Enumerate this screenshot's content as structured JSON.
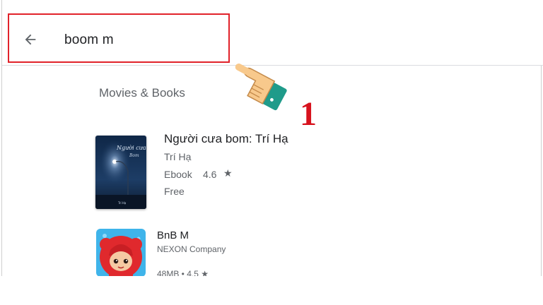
{
  "search": {
    "query": "boom m",
    "back_icon": "arrow-left-icon"
  },
  "section": {
    "title": "Movies & Books"
  },
  "book": {
    "title": "Người cưa bom: Trí Hạ",
    "author": "Trí Hạ",
    "type": "Ebook",
    "rating": "4.6",
    "star": "★",
    "price": "Free",
    "cover_title_line1": "Người cưa",
    "cover_title_line2": "Bom",
    "cover_author": "Trí Hạ"
  },
  "app": {
    "title": "BnB M",
    "developer": "NEXON Company",
    "meta": "48MB • 4.5 ★"
  },
  "annotation": {
    "step_number": "1",
    "highlight_color": "#e1222a",
    "step_color": "#d7121d"
  }
}
